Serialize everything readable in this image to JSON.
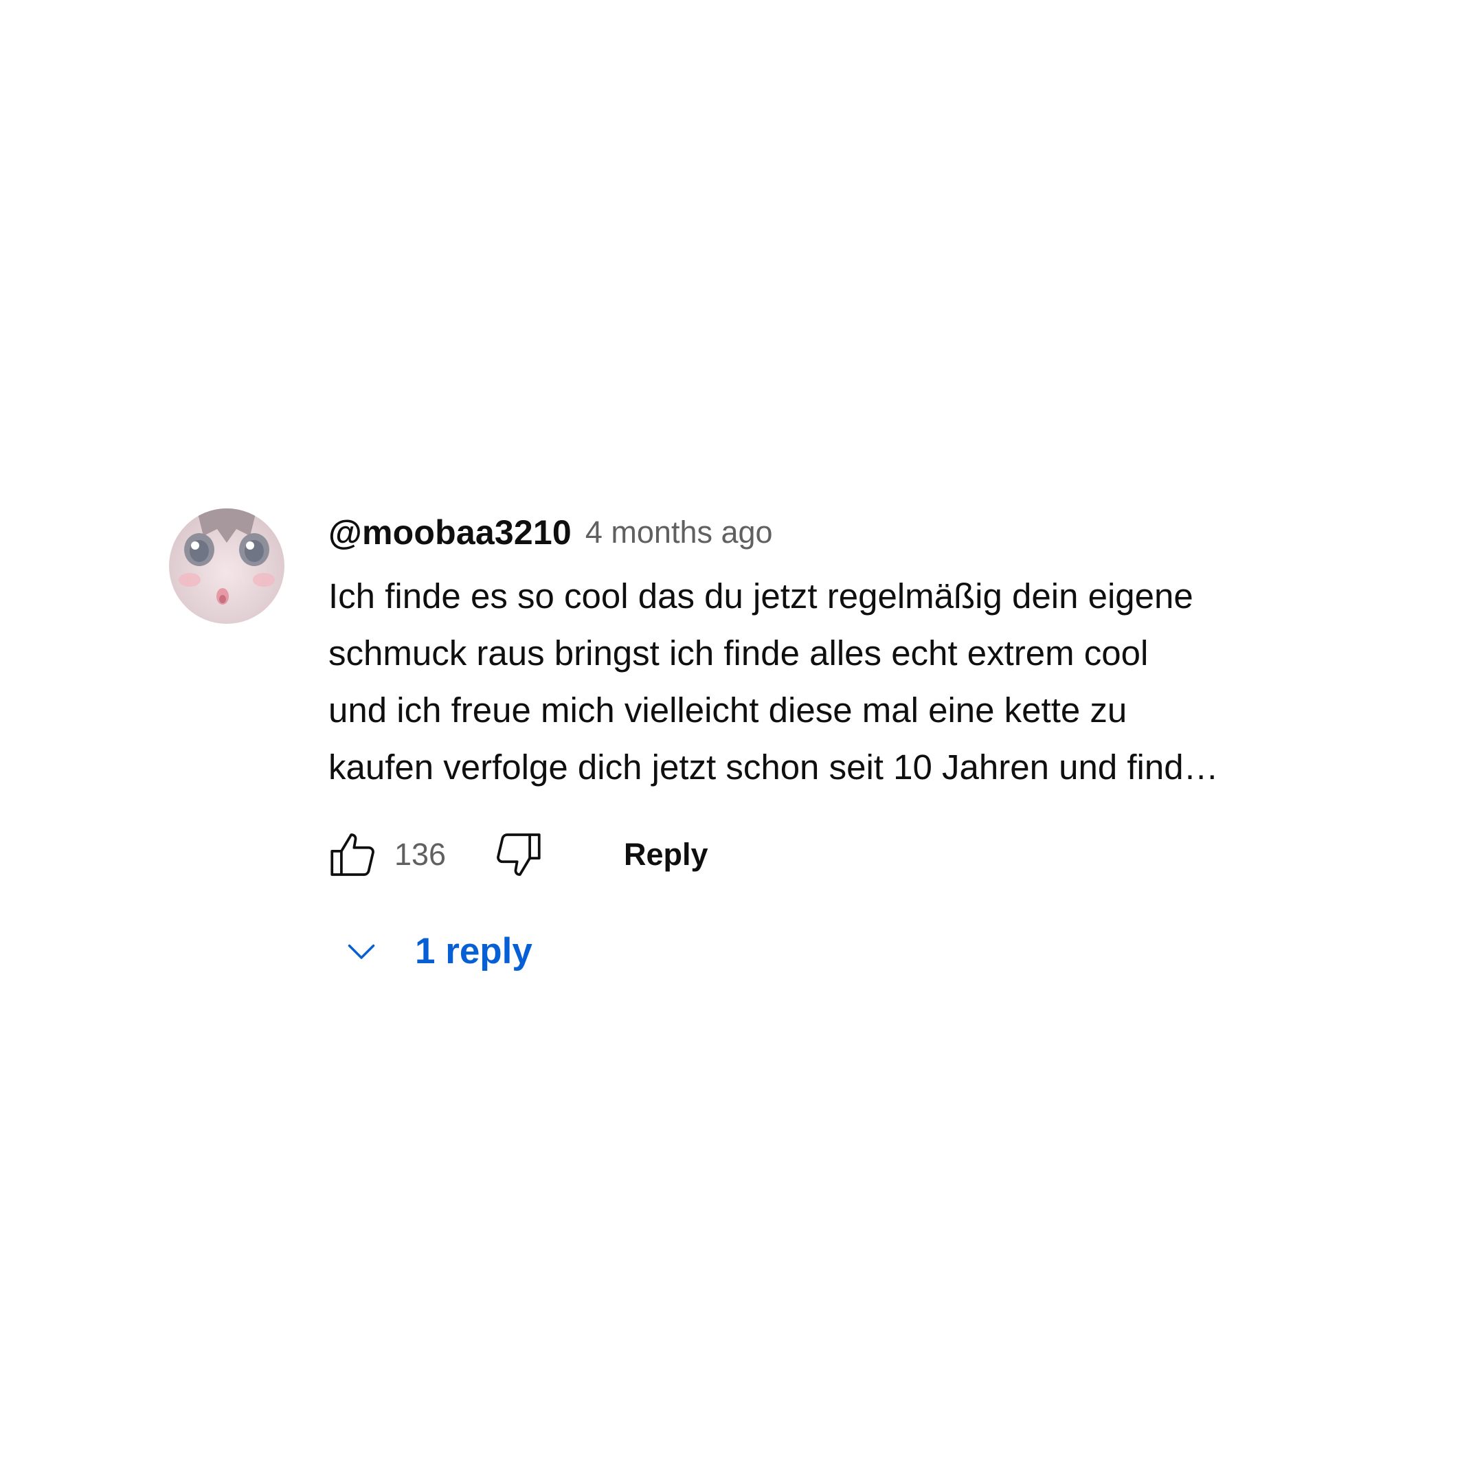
{
  "comment": {
    "author": "@moobaa3210",
    "timestamp": "4 months ago",
    "text_lines": [
      "Ich finde es so cool das du jetzt regelmäßig dein eigene",
      "schmuck raus bringst ich finde alles echt extrem cool",
      "und ich freue mich vielleicht diese mal eine kette zu",
      "kaufen verfolge dich jetzt schon seit 10 Jahren und find…"
    ],
    "like_count": "136",
    "reply_label": "Reply",
    "replies_label": "1 reply"
  },
  "icons": {
    "like": "thumbs-up-icon",
    "dislike": "thumbs-down-icon",
    "expand": "chevron-down-icon",
    "avatar": "anime-face-avatar"
  },
  "colors": {
    "text_primary": "#0f0f0f",
    "text_secondary": "#606060",
    "link_blue": "#065fd4",
    "background": "#ffffff"
  }
}
